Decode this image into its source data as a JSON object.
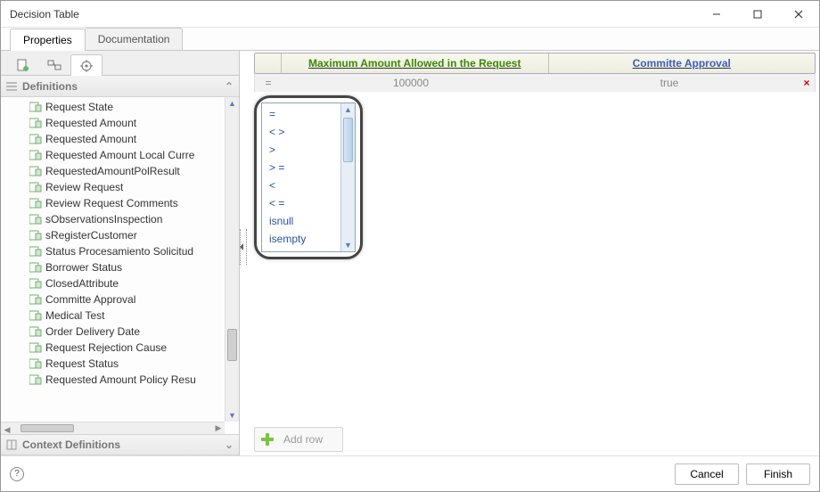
{
  "title": "Decision Table",
  "tabs": [
    {
      "label": "Properties",
      "active": true
    },
    {
      "label": "Documentation",
      "active": false
    }
  ],
  "sidebar": {
    "section_definitions": "Definitions",
    "section_context": "Context Definitions",
    "items": [
      "Request State",
      "Requested Amount",
      "Requested Amount",
      "Requested Amount Local Curre",
      "RequestedAmountPolResult",
      "Review Request",
      "Review Request Comments",
      "sObservationsInspection",
      "sRegisterCustomer",
      "Status Procesamiento Solicitud",
      "Borrower Status",
      "ClosedAttribute",
      "Committe Approval",
      "Medical Test",
      "Order Delivery Date",
      "Request Rejection Cause",
      "Request Status",
      "Requested Amount Policy Resu"
    ]
  },
  "grid": {
    "columns": [
      "Maximum Amount Allowed in the Request",
      "Committe Approval"
    ],
    "row_operator": "=",
    "row_values": [
      "100000",
      "true"
    ]
  },
  "operator_dropdown": [
    "=",
    "< >",
    ">",
    "> =",
    "<",
    "< =",
    "isnull",
    "isempty"
  ],
  "addrow_label": "Add row",
  "buttons": {
    "cancel": "Cancel",
    "finish": "Finish"
  }
}
